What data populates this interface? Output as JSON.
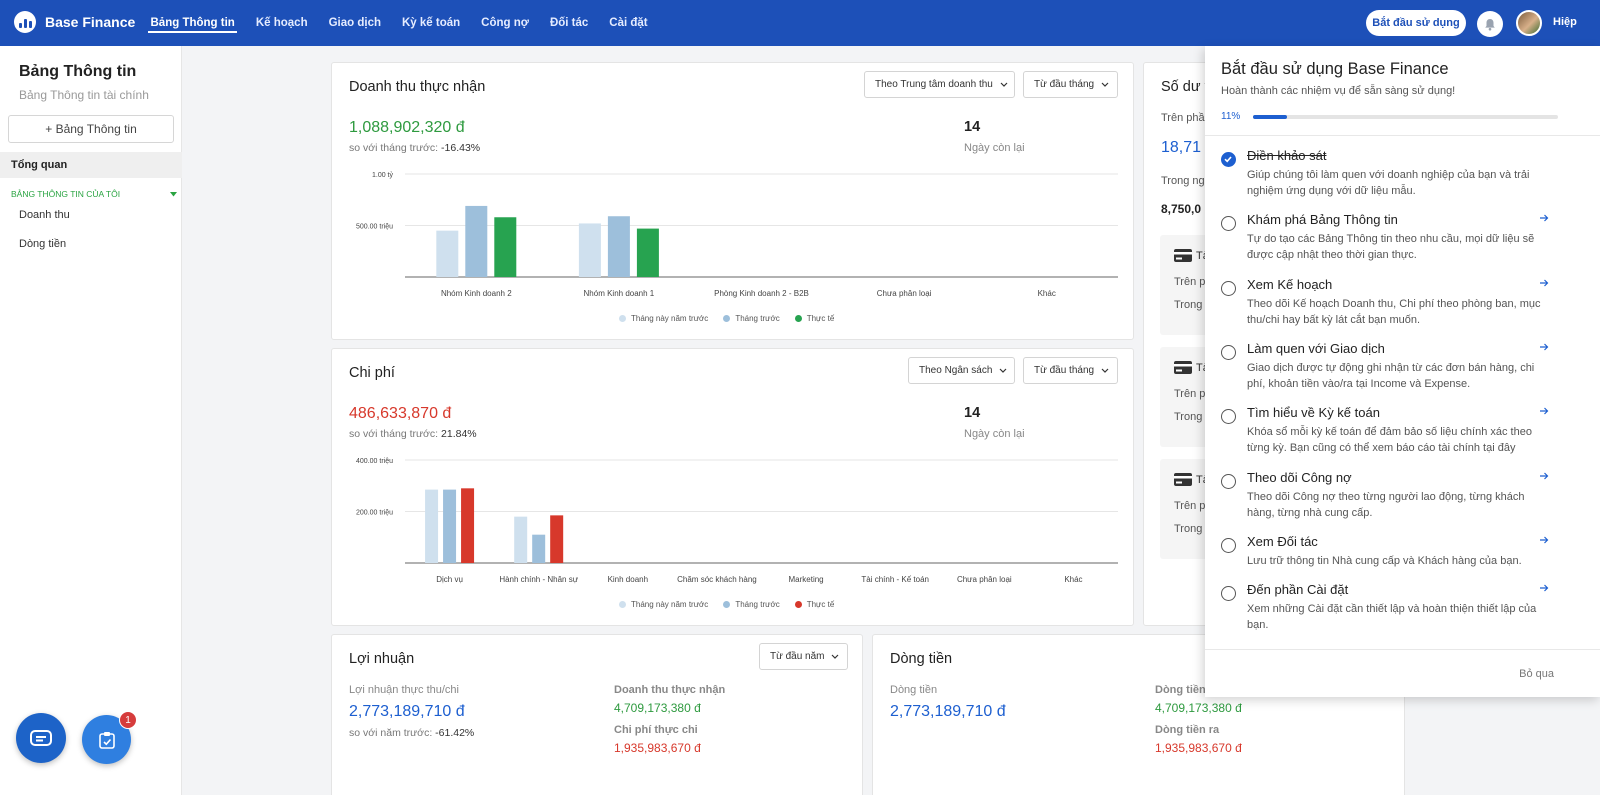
{
  "header": {
    "brand": "Base Finance",
    "nav": [
      "Bảng Thông tin",
      "Kế hoạch",
      "Giao dịch",
      "Kỳ kế toán",
      "Công nợ",
      "Đối tác",
      "Cài đặt"
    ],
    "start_button": "Bắt đầu sử dụng",
    "user_name": "Hiệp"
  },
  "sidebar": {
    "title": "Bảng Thông tin",
    "subtitle": "Bảng Thông tin tài chính",
    "add_button": "+ Bảng Thông tin",
    "overview": "Tổng quan",
    "section_label": "BẢNG THÔNG TIN CỦA TÔI",
    "items": [
      "Doanh thu",
      "Dòng tiền"
    ]
  },
  "revenue": {
    "title": "Doanh thu thực nhận",
    "filter_group": "Theo Trung tâm doanh thu",
    "filter_period": "Từ đầu tháng",
    "amount": "1,088,902,320 đ",
    "compare_label": "so với tháng trước:",
    "compare_value": "-16.43%",
    "days_num": "14",
    "days_label": "Ngày còn lại"
  },
  "expense": {
    "title": "Chi phí",
    "filter_group": "Theo Ngân sách",
    "filter_period": "Từ đầu tháng",
    "amount": "486,633,870 đ",
    "compare_label": "so với tháng trước:",
    "compare_value": "21.84%",
    "days_num": "14",
    "days_label": "Ngày còn lại"
  },
  "balance": {
    "title": "Số dư t",
    "row1_label": "Trên phầ",
    "row1_value": "18,71",
    "row2_label": "Trong ng",
    "row2_value": "8,750,0",
    "accounts": [
      {
        "name": "Tà",
        "l1": "Trên p",
        "l2": "Trong"
      },
      {
        "name": "Tà",
        "l1": "Trên p",
        "l2": "Trong"
      },
      {
        "name": "Tà",
        "l1": "Trên p",
        "l2": "Trong"
      }
    ]
  },
  "profit": {
    "title": "Lợi nhuận",
    "filter_period": "Từ đầu năm",
    "main_label": "Lợi nhuận thực thu/chi",
    "main_value": "2,773,189,710 đ",
    "compare_label": "so với năm trước:",
    "compare_value": "-61.42%",
    "rev_label": "Doanh thu thực nhận",
    "rev_value": "4,709,173,380 đ",
    "exp_label": "Chi phí thực chi",
    "exp_value": "1,935,983,670 đ"
  },
  "cashflow": {
    "title": "Dòng tiền",
    "main_label": "Dòng tiền",
    "main_value": "2,773,189,710 đ",
    "in_label": "Dòng tiền",
    "in_value": "4,709,173,380 đ",
    "out_label": "Dòng tiền ra",
    "out_value": "1,935,983,670 đ"
  },
  "onboarding": {
    "title": "Bắt đầu sử dụng Base Finance",
    "subtitle": "Hoàn thành các nhiệm vụ để sẵn sàng sử dụng!",
    "progress_label": "11%",
    "progress": 0.11,
    "tasks": [
      {
        "title": "Điền khảo sát",
        "desc": "Giúp chúng tôi làm quen với doanh nghiệp của bạn và trải nghiệm ứng dụng với dữ liệu mẫu.",
        "done": true
      },
      {
        "title": "Khám phá Bảng Thông tin",
        "desc": "Tự do tạo các Bảng Thông tin theo nhu cầu, mọi dữ liệu sẽ được cập nhật theo thời gian thực.",
        "done": false
      },
      {
        "title": "Xem Kế hoạch",
        "desc": "Theo dõi Kế hoạch Doanh thu, Chi phí theo phòng ban, mục thu/chi hay bất kỳ lát cắt bạn muốn.",
        "done": false
      },
      {
        "title": "Làm quen với Giao dịch",
        "desc": "Giao dịch được tự động ghi nhận từ các đơn bán hàng, chi phí, khoản tiền vào/ra tại Income và Expense.",
        "done": false
      },
      {
        "title": "Tìm hiểu về Kỳ kế toán",
        "desc": "Khóa sổ mỗi kỳ kế toán để đảm bảo số liệu chính xác theo từng kỳ. Bạn cũng có thể xem báo cáo tài chính tại đây",
        "done": false
      },
      {
        "title": "Theo dõi Công nợ",
        "desc": "Theo dõi Công nợ theo từng người lao động, từng khách hàng, từng nhà cung cấp.",
        "done": false
      },
      {
        "title": "Xem Đối tác",
        "desc": "Lưu trữ thông tin Nhà cung cấp và Khách hàng của bạn.",
        "done": false
      },
      {
        "title": "Đến phần Cài đặt",
        "desc": "Xem những Cài đặt cần thiết lập và hoàn thiện thiết lập của bạn.",
        "done": false
      }
    ],
    "skip": "Bỏ qua"
  },
  "notification_count": "1",
  "colors": {
    "primary": "#1d50b8",
    "green": "#2e9a3f",
    "red": "#d7382b",
    "lightblue": "#cfe0ee",
    "midblue": "#9dbfdb"
  },
  "chart_data": [
    {
      "type": "bar",
      "categories": [
        "Nhóm Kinh doanh 2",
        "Nhóm Kinh doanh 1",
        "Phòng Kinh doanh 2 - B2B",
        "Chưa phân loại",
        "Khác"
      ],
      "series": [
        {
          "name": "Tháng này năm trước",
          "values": [
            450,
            520,
            0,
            0,
            0
          ]
        },
        {
          "name": "Tháng trước",
          "values": [
            690,
            590,
            0,
            0,
            0
          ]
        },
        {
          "name": "Thực tế",
          "values": [
            580,
            470,
            0,
            0,
            0
          ]
        }
      ],
      "ytick_labels": [
        "1.00 tỷ",
        "500.00 triệu"
      ],
      "yticks": [
        1000,
        500
      ],
      "ylim": [
        0,
        1000
      ],
      "unit": "triệu",
      "colors": [
        "#cfe0ee",
        "#9dbfdb",
        "#27a350"
      ]
    },
    {
      "type": "bar",
      "categories": [
        "Dịch vụ",
        "Hành chính - Nhân sự",
        "Kinh doanh",
        "Chăm sóc khách hàng",
        "Marketing",
        "Tài chính - Kế toán",
        "Chưa phân loại",
        "Khác"
      ],
      "series": [
        {
          "name": "Tháng này năm trước",
          "values": [
            285,
            180,
            0,
            0,
            0,
            0,
            0,
            0
          ]
        },
        {
          "name": "Tháng trước",
          "values": [
            285,
            110,
            0,
            0,
            0,
            0,
            0,
            0
          ]
        },
        {
          "name": "Thực tế",
          "values": [
            290,
            185,
            0,
            0,
            0,
            0,
            0,
            0
          ]
        }
      ],
      "ytick_labels": [
        "400.00 triệu",
        "200.00 triệu"
      ],
      "yticks": [
        400,
        200
      ],
      "ylim": [
        0,
        400
      ],
      "unit": "triệu",
      "colors": [
        "#cfe0ee",
        "#9dbfdb",
        "#d7382b"
      ]
    }
  ]
}
